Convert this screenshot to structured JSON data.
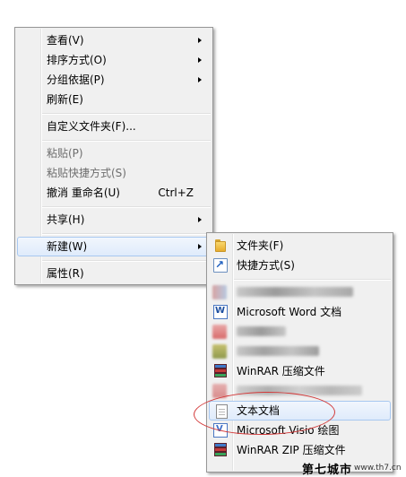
{
  "context_menu": {
    "items": [
      {
        "label": "查看(V)"
      },
      {
        "label": "排序方式(O)"
      },
      {
        "label": "分组依据(P)"
      },
      {
        "label": "刷新(E)"
      },
      {
        "label": "自定义文件夹(F)..."
      },
      {
        "label": "粘贴(P)"
      },
      {
        "label": "粘贴快捷方式(S)"
      },
      {
        "label": "撤消 重命名(U)",
        "shortcut": "Ctrl+Z"
      },
      {
        "label": "共享(H)"
      },
      {
        "label": "新建(W)"
      },
      {
        "label": "属性(R)"
      }
    ]
  },
  "new_submenu": {
    "items": [
      {
        "label": "文件夹(F)",
        "icon": "folder-icon"
      },
      {
        "label": "快捷方式(S)",
        "icon": "shortcut-icon"
      },
      {
        "label": "",
        "icon": "blurred-icon"
      },
      {
        "label": "Microsoft Word 文档",
        "icon": "word-document-icon"
      },
      {
        "label": "",
        "icon": "blurred-icon"
      },
      {
        "label": "",
        "icon": "blurred-icon"
      },
      {
        "label": "WinRAR 压缩文件",
        "icon": "winrar-icon"
      },
      {
        "label": "",
        "icon": "blurred-icon"
      },
      {
        "label": "文本文档",
        "icon": "text-document-icon"
      },
      {
        "label": "Microsoft Visio 绘图",
        "icon": "visio-icon"
      },
      {
        "label": "WinRAR ZIP 压缩文件",
        "icon": "winrar-zip-icon"
      }
    ]
  },
  "watermark": {
    "site_name": "第七城市",
    "url": "www.th7.cn"
  },
  "colors": {
    "menu_background": "#f0f0f0",
    "hover_border": "#a8c8f0",
    "annotation_circle": "#d33a3a"
  }
}
